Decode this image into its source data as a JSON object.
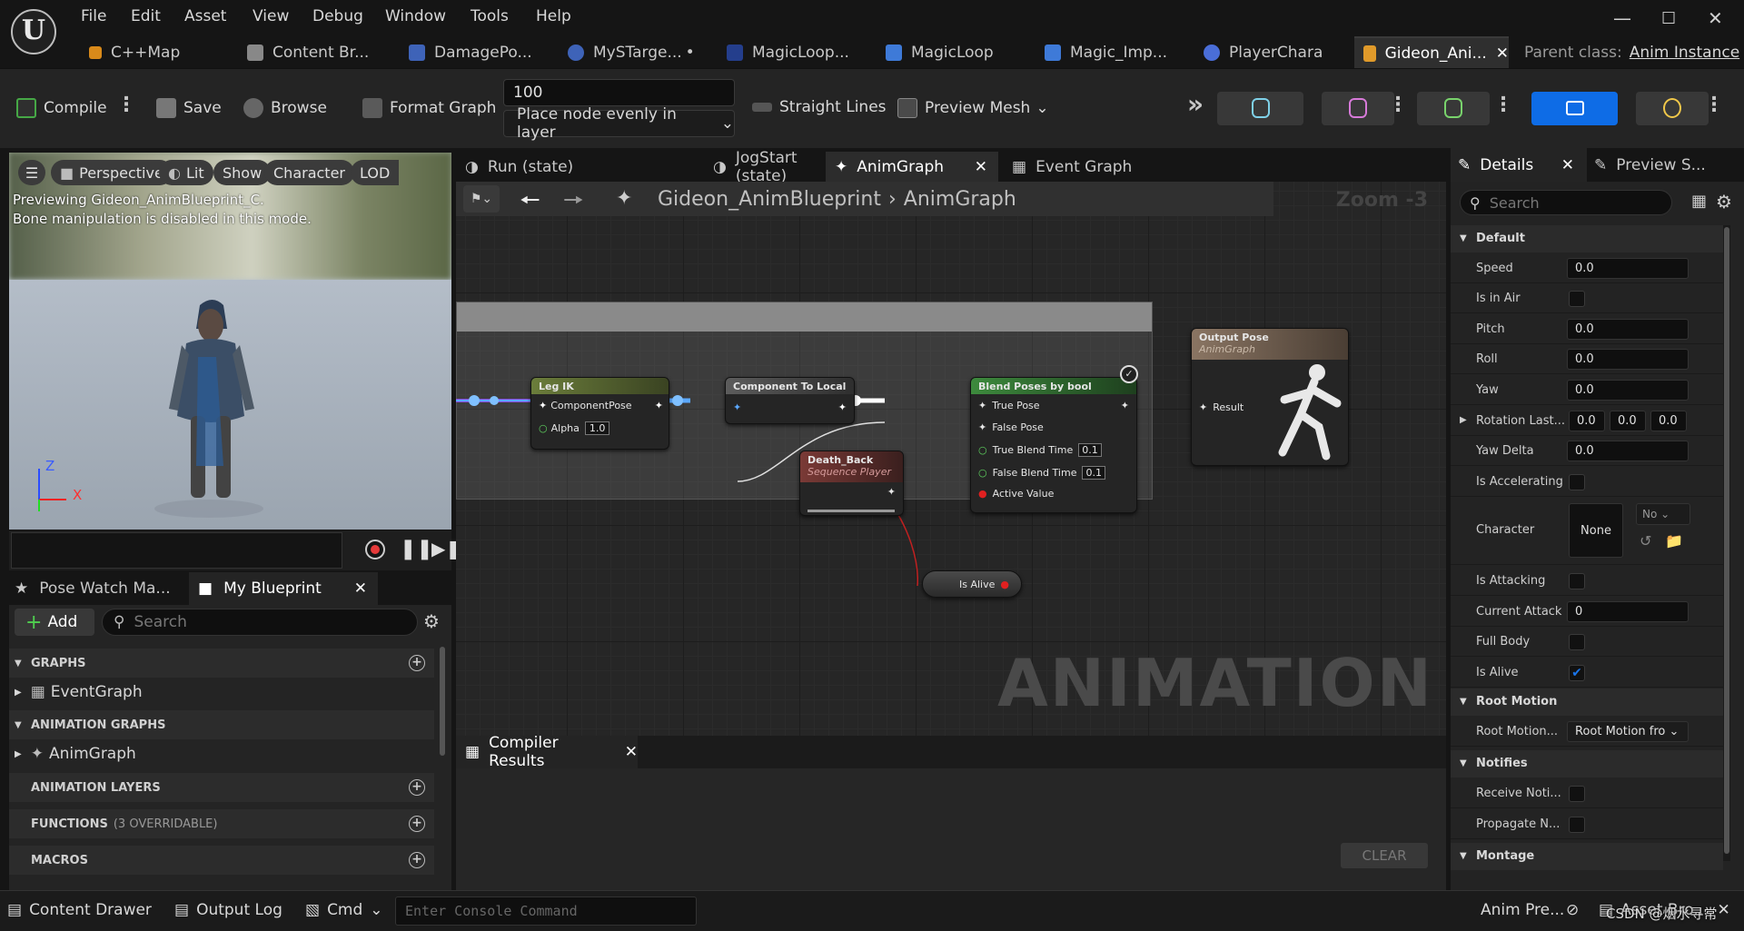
{
  "menu": [
    "File",
    "Edit",
    "Asset",
    "View",
    "Debug",
    "Window",
    "Tools",
    "Help"
  ],
  "tabs": [
    {
      "label": "C++Map"
    },
    {
      "label": "Content Br..."
    },
    {
      "label": "DamagePo..."
    },
    {
      "label": "MySTarge..."
    },
    {
      "label": "MagicLoop..."
    },
    {
      "label": "MagicLoop"
    },
    {
      "label": "Magic_Imp..."
    },
    {
      "label": "PlayerChara"
    },
    {
      "label": "Gideon_Ani..."
    }
  ],
  "parent_class": {
    "label": "Parent class:",
    "value": "Anim Instance"
  },
  "toolbar": {
    "compile": "Compile",
    "save": "Save",
    "browse": "Browse",
    "format_graph": "Format Graph",
    "spacing_value": "100",
    "layer_mode": "Place node evenly in layer",
    "straight_lines": "Straight Lines",
    "preview_mesh": "Preview Mesh"
  },
  "viewport": {
    "buttons": [
      "Perspective",
      "Lit",
      "Show",
      "Character",
      "LOD"
    ],
    "info_line1": "Previewing Gideon_AnimBlueprint_C.",
    "info_line2": "Bone manipulation is disabled in this mode.",
    "axis_z": "Z",
    "axis_x": "X"
  },
  "left_tabs": {
    "pose_watch": "Pose Watch Ma...",
    "my_blueprint": "My Blueprint"
  },
  "my_blueprint": {
    "add": "Add",
    "search_placeholder": "Search",
    "graphs": "GRAPHS",
    "event_graph": "EventGraph",
    "anim_graphs": "ANIMATION GRAPHS",
    "anim_graph": "AnimGraph",
    "anim_layers": "ANIMATION LAYERS",
    "functions": "FUNCTIONS",
    "functions_note": "(3 OVERRIDABLE)",
    "macros": "MACROS"
  },
  "graph_tabs": [
    "Run (state)",
    "JogStart (state)",
    "AnimGraph",
    "Event Graph"
  ],
  "breadcrumb": {
    "root": "Gideon_AnimBlueprint",
    "leaf": "AnimGraph",
    "zoom": "Zoom -3"
  },
  "nodes": {
    "leg_ik": {
      "title": "Leg IK",
      "pin1": "ComponentPose",
      "pin2": "Alpha",
      "alpha": "1.0"
    },
    "to_local": {
      "title": "Component To Local"
    },
    "blend": {
      "title": "Blend Poses by bool",
      "pins": [
        "True Pose",
        "False Pose",
        "True Blend Time",
        "False Blend Time",
        "Active Value"
      ],
      "true_time": "0.1",
      "false_time": "0.1"
    },
    "death": {
      "title": "Death_Back",
      "subtitle": "Sequence Player"
    },
    "output": {
      "title": "Output Pose",
      "subtitle": "AnimGraph",
      "pin": "Result"
    },
    "is_alive": {
      "title": "Is Alive"
    }
  },
  "watermark": "ANIMATION",
  "compiler": {
    "tab": "Compiler Results",
    "clear": "CLEAR"
  },
  "details": {
    "tab": "Details",
    "tab2": "Preview S...",
    "search_placeholder": "Search",
    "sec_default": "Default",
    "sec_root": "Root Motion",
    "sec_notifies": "Notifies",
    "sec_montage": "Montage",
    "speed": {
      "label": "Speed",
      "value": "0.0"
    },
    "is_in_air": {
      "label": "Is in Air"
    },
    "pitch": {
      "label": "Pitch",
      "value": "0.0"
    },
    "roll": {
      "label": "Roll",
      "value": "0.0"
    },
    "yaw": {
      "label": "Yaw",
      "value": "0.0"
    },
    "rotation_last": {
      "label": "Rotation Last...",
      "x": "0.0",
      "y": "0.0",
      "z": "0.0"
    },
    "yaw_delta": {
      "label": "Yaw Delta",
      "value": "0.0"
    },
    "is_accelerating": {
      "label": "Is Accelerating"
    },
    "character": {
      "label": "Character",
      "value": "None",
      "dropdown": "No"
    },
    "is_attacking": {
      "label": "Is Attacking"
    },
    "current_attack": {
      "label": "Current Attack",
      "value": "0"
    },
    "full_body": {
      "label": "Full Body"
    },
    "is_alive": {
      "label": "Is Alive",
      "checked": true
    },
    "root_motion": {
      "label": "Root Motion...",
      "value": "Root Motion fro"
    },
    "receive_noti": {
      "label": "Receive Noti..."
    },
    "propagate": {
      "label": "Propagate N..."
    }
  },
  "status": {
    "content_drawer": "Content Drawer",
    "output_log": "Output Log",
    "cmd": "Cmd",
    "console_placeholder": "Enter Console Command",
    "anim_pre": "Anim Pre...",
    "asset_bro": "Asset Bro...",
    "watermark": "CSDN @烟水寻常"
  },
  "colors": {
    "accent_blue": "#0e6ce6",
    "check_blue": "#1a74e8",
    "exec_blue": "#5ba8ff",
    "pose_purple": "#8b4bd9"
  }
}
